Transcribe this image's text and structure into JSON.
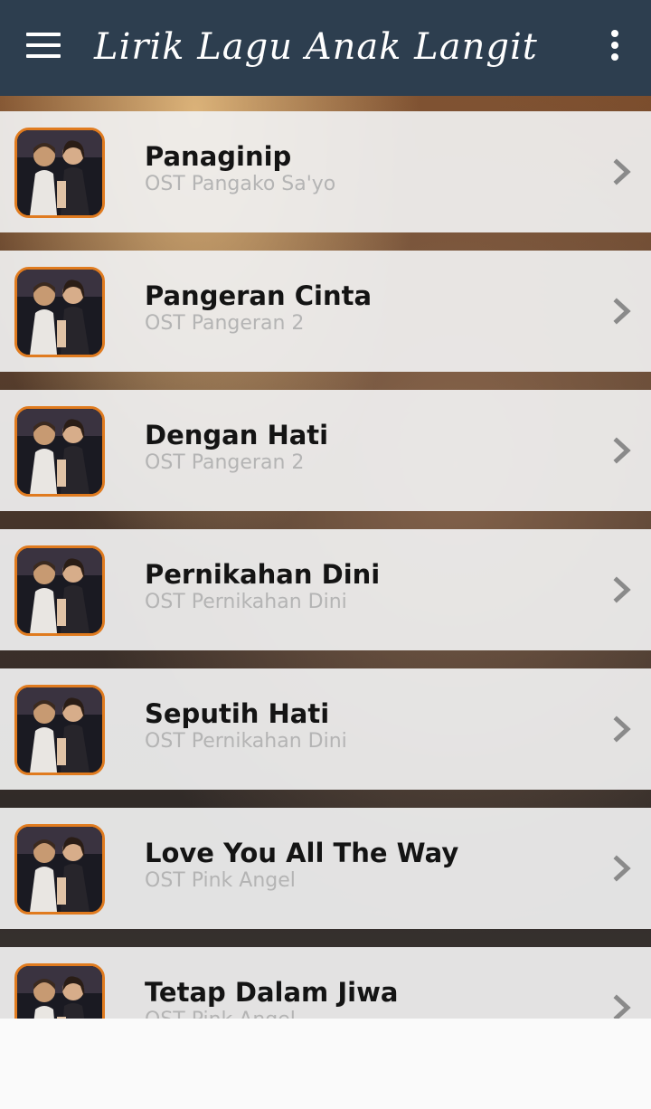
{
  "app_bar": {
    "title": "Lirik Lagu Anak Langit",
    "menu_icon": "hamburger-menu-icon",
    "overflow_icon": "more-vert-icon",
    "background": "#2d3e4f"
  },
  "songs": [
    {
      "title": "Panaginip",
      "subtitle": "OST Pangako Sa'yo"
    },
    {
      "title": "Pangeran Cinta",
      "subtitle": "OST Pangeran 2"
    },
    {
      "title": "Dengan Hati",
      "subtitle": "OST Pangeran 2"
    },
    {
      "title": "Pernikahan Dini",
      "subtitle": "OST Pernikahan Dini"
    },
    {
      "title": "Seputih Hati",
      "subtitle": "OST Pernikahan Dini"
    },
    {
      "title": "Love You All The Way",
      "subtitle": "OST Pink Angel"
    },
    {
      "title": "Tetap Dalam Jiwa",
      "subtitle": "OST Pink Angel"
    }
  ],
  "icons": {
    "thumbnail": "album-art-icon",
    "chevron": "chevron-right-icon"
  },
  "colors": {
    "thumbnail_border": "#e07b1f",
    "title_text": "#141414",
    "subtitle_text": "#b4b4b4",
    "chevron": "#8a8a8a"
  }
}
